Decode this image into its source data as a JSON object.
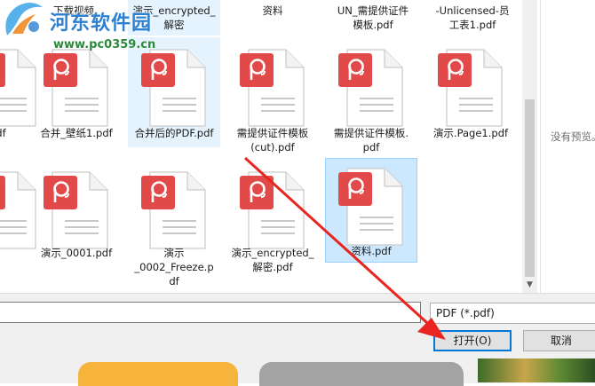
{
  "watermark": {
    "title": "河东软件园",
    "url": "www.pc0359.cn"
  },
  "top_row_labels": [
    [
      "下载视频"
    ],
    [
      "演示_encrypted_",
      "解密"
    ],
    [
      "资料"
    ],
    [
      "UN_需提供证件",
      "模板.pdf"
    ],
    [
      "-Unlicensed-员",
      "工表1.pdf"
    ]
  ],
  "row1": [
    {
      "lines": [
        "pdf"
      ]
    },
    {
      "lines": [
        "合并_壁纸1.pdf"
      ]
    },
    {
      "lines": [
        "合并后的PDF.pdf"
      ]
    },
    {
      "lines": [
        "需提供证件模板",
        "(cut).pdf"
      ]
    },
    {
      "lines": [
        "需提供证件模板.",
        "pdf"
      ]
    },
    {
      "lines": [
        "演示.Page1.pdf"
      ]
    }
  ],
  "row2": [
    {
      "lines": [
        "演示_0001.pdf"
      ]
    },
    {
      "lines": [
        "演示",
        "_0002_Freeze.p",
        "df"
      ]
    },
    {
      "lines": [
        "演示_encrypted_",
        "解密.pdf"
      ]
    },
    {
      "lines": [
        "资料.pdf"
      ]
    }
  ],
  "preview": {
    "text": "没有预览。"
  },
  "filetype": {
    "selected": "PDF (*.pdf)"
  },
  "buttons": {
    "open": "打开(O)",
    "cancel": "取消"
  },
  "colors": {
    "pdf_badge": "#e24a4a",
    "selection": "#cce8ff",
    "accent": "#0078d7",
    "arrow": "#e8261f"
  }
}
